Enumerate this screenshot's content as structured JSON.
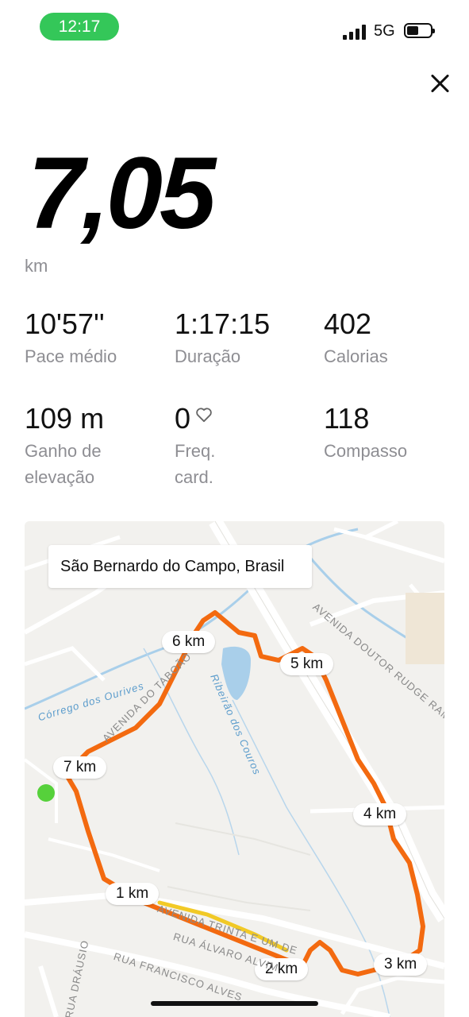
{
  "status_bar": {
    "time": "12:17",
    "network": "5G"
  },
  "summary": {
    "distance": "7,05",
    "distance_unit": "km"
  },
  "stats": [
    {
      "value": "10'57''",
      "label": "Pace médio"
    },
    {
      "value": "1:17:15",
      "label": "Duração"
    },
    {
      "value": "402",
      "label": "Calorias"
    },
    {
      "value": "109 m",
      "label": "Ganho de elevação"
    },
    {
      "value": "0",
      "label": "Freq. card."
    },
    {
      "value": "118",
      "label": "Compasso"
    }
  ],
  "map": {
    "location": "São Bernardo do Campo, Brasil",
    "km_markers": [
      "1 km",
      "2 km",
      "3 km",
      "4 km",
      "5 km",
      "6 km",
      "7 km"
    ],
    "streets": {
      "avenida_taboao": "AVENIDA DO TABOÃO",
      "avenida_rudge": "AVENIDA DOUTOR RUDGE RAMOS",
      "avenida_trinta": "AVENIDA TRINTA E UM DE",
      "rua_alvaro": "RUA ÁLVARO ALVIM",
      "rua_francisco": "RUA FRANCISCO ALVES",
      "rua_drausio": "RUA DRÁUSIO"
    },
    "water": {
      "corrego": "Córrego dos Ourives",
      "ribeirao": "Ribeirão dos Couros"
    }
  }
}
